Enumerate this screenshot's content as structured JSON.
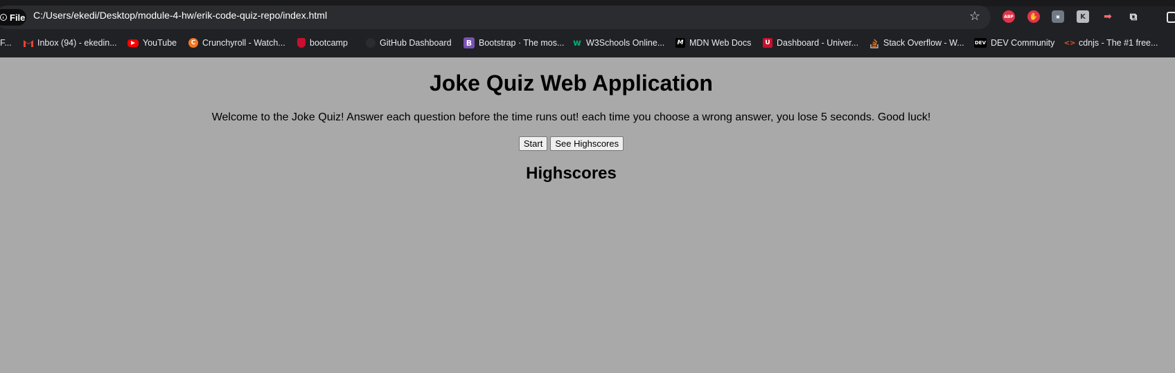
{
  "browser": {
    "address_chip": "File",
    "url": "C:/Users/ekedi/Desktop/module-4-hw/erik-code-quiz-repo/index.html",
    "extensions": {
      "abp_label": "ABP"
    },
    "bookmarks": [
      {
        "label": "F...",
        "icon": "folder-icon"
      },
      {
        "label": "Inbox (94) - ekedin...",
        "icon": "gmail-icon"
      },
      {
        "label": "YouTube",
        "icon": "youtube-icon"
      },
      {
        "label": "Crunchyroll - Watch...",
        "icon": "crunchyroll-icon"
      },
      {
        "label": "bootcamp",
        "icon": "bootcamp-icon"
      },
      {
        "label": "GitHub Dashboard",
        "icon": "github-icon"
      },
      {
        "label": "Bootstrap · The mos...",
        "icon": "bootstrap-icon",
        "glyph": "B"
      },
      {
        "label": "W3Schools Online...",
        "icon": "w3schools-icon",
        "glyph": "w"
      },
      {
        "label": "MDN Web Docs",
        "icon": "mdn-icon",
        "glyph": "M"
      },
      {
        "label": "Dashboard - Univer...",
        "icon": "university-icon",
        "glyph": "U"
      },
      {
        "label": "Stack Overflow - W...",
        "icon": "stackoverflow-icon"
      },
      {
        "label": "DEV Community",
        "icon": "dev-icon",
        "glyph": "DEV"
      },
      {
        "label": "cdnjs - The #1 free...",
        "icon": "cdnjs-icon",
        "glyph": "<>"
      }
    ]
  },
  "page": {
    "title": "Joke Quiz Web Application",
    "welcome": "Welcome to the Joke Quiz! Answer each question before the time runs out! each time you choose a wrong answer, you lose 5 seconds. Good luck!",
    "start_label": "Start",
    "highscores_button_label": "See Highscores",
    "highscores_heading": "Highscores",
    "background_color": "#a9a9a9"
  }
}
